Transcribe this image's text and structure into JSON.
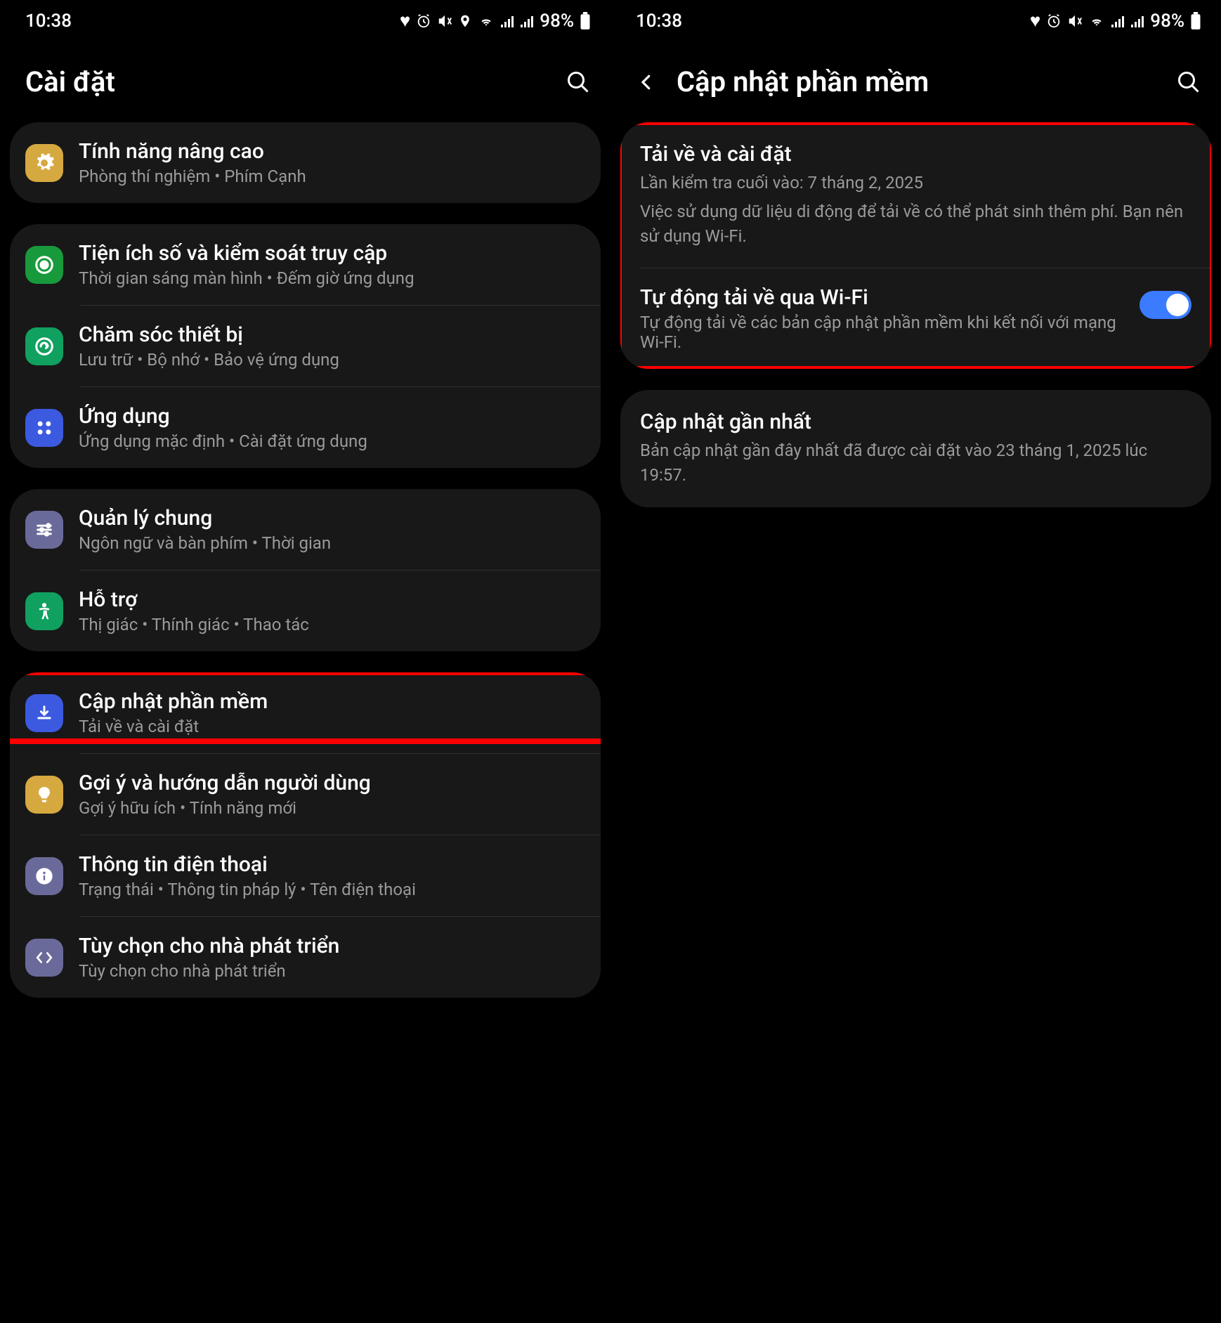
{
  "status": {
    "time": "10:38",
    "battery": "98%"
  },
  "left": {
    "title": "Cài đặt",
    "g0": {
      "advanced": {
        "title": "Tính năng nâng cao",
        "sub": "Phòng thí nghiệm  •  Phím Cạnh"
      }
    },
    "g1": {
      "digital": {
        "title": "Tiện ích số và kiểm soát truy cập",
        "sub": "Thời gian sáng màn hình  •  Đếm giờ ứng dụng"
      },
      "care": {
        "title": "Chăm sóc thiết bị",
        "sub": "Lưu trữ  •  Bộ nhớ  •  Bảo vệ ứng dụng"
      },
      "apps": {
        "title": "Ứng dụng",
        "sub": "Ứng dụng mặc định  •  Cài đặt ứng dụng"
      }
    },
    "g2": {
      "general": {
        "title": "Quản lý chung",
        "sub": "Ngôn ngữ và bàn phím  •  Thời gian"
      },
      "access": {
        "title": "Hỗ trợ",
        "sub": "Thị giác  •  Thính giác  •  Thao tác"
      }
    },
    "g3": {
      "update": {
        "title": "Cập nhật phần mềm",
        "sub": "Tải về và cài đặt"
      },
      "tips": {
        "title": "Gợi ý và hướng dẫn người dùng",
        "sub": "Gợi ý hữu ích  •  Tính năng mới"
      },
      "about": {
        "title": "Thông tin điện thoại",
        "sub": "Trạng thái  •  Thông tin pháp lý  •  Tên điện thoại"
      },
      "dev": {
        "title": "Tùy chọn cho nhà phát triển",
        "sub": "Tùy chọn cho nhà phát triển"
      }
    }
  },
  "right": {
    "title": "Cập nhật phần mềm",
    "download": {
      "title": "Tải về và cài đặt",
      "line1": "Lần kiểm tra cuối vào: 7 tháng 2, 2025",
      "line2": "Việc sử dụng dữ liệu di động để tải về có thể phát sinh thêm phí. Bạn nên sử dụng Wi-Fi."
    },
    "auto": {
      "title": "Tự động tải về qua Wi-Fi",
      "sub": "Tự động tải về các bản cập nhật phần mềm khi kết nối với mạng Wi-Fi."
    },
    "last": {
      "title": "Cập nhật gần nhất",
      "sub": "Bản cập nhật gần đây nhất đã được cài đặt vào 23 tháng 1, 2025 lúc 19:57."
    }
  },
  "colors": {
    "advanced": "#d6a840",
    "digital": "#189a3c",
    "care": "#10a060",
    "apps": "#3c5ae0",
    "general": "#6a6a9a",
    "access": "#10a060",
    "update": "#3c5ae0",
    "tips": "#d6a840",
    "about": "#6a6a9a",
    "dev": "#6a6a9a"
  }
}
